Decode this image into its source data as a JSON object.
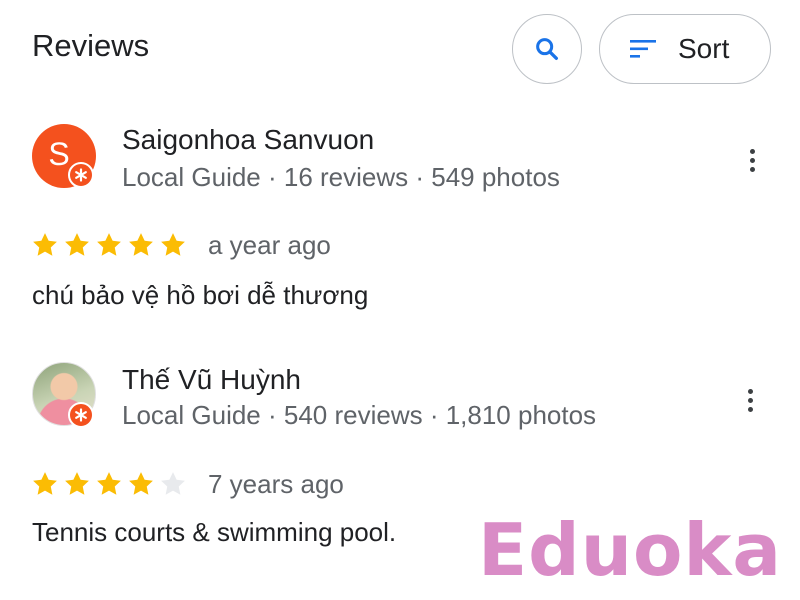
{
  "header": {
    "title": "Reviews",
    "sort_label": "Sort"
  },
  "reviews": [
    {
      "avatar_letter": "S",
      "name": "Saigonhoa Sanvuon",
      "meta": "Local Guide · 16 reviews · 549 photos",
      "rating": 5,
      "time": "a year ago",
      "text": "chú bảo vệ hồ bơi dễ thương"
    },
    {
      "name": "Thế Vũ Huỳnh",
      "meta": "Local Guide · 540 reviews · 1,810 photos",
      "rating": 4,
      "time": "7 years ago",
      "text": "Tennis courts & swimming pool."
    }
  ],
  "watermark": "Eduoka",
  "colors": {
    "star_filled": "#fbbc04",
    "star_empty": "#e8eaed",
    "accent_blue": "#1a73e8",
    "avatar_orange": "#f4511e",
    "watermark": "#d98cc6"
  },
  "icons": {
    "search": "search-icon",
    "sort": "sort-icon",
    "more": "more-vert-icon",
    "local_guide_badge": "local-guide-badge-icon",
    "star": "star-icon"
  }
}
